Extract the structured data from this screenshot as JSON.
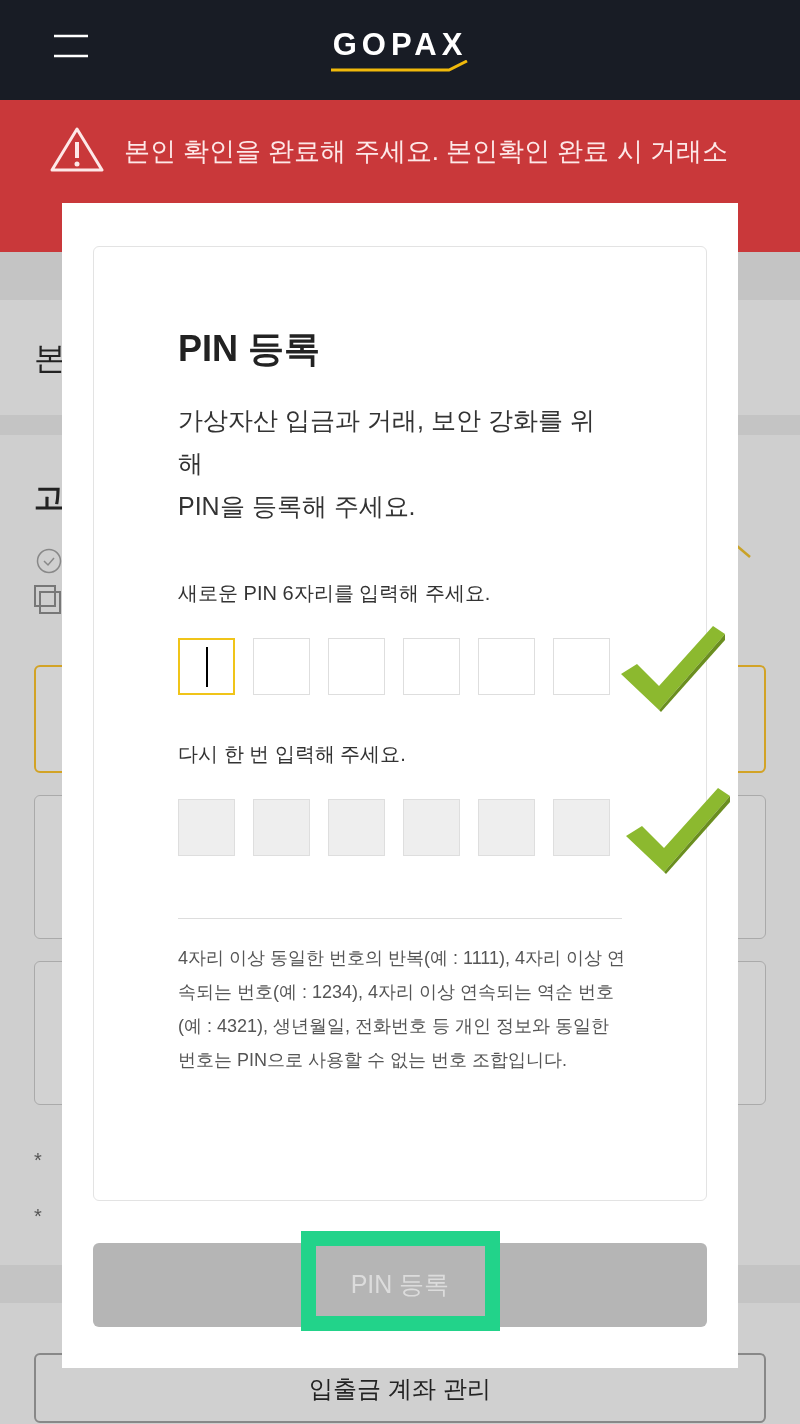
{
  "header": {
    "logo": "GOPAX"
  },
  "banner": {
    "message": "본인 확인을 완료해 주세요. 본인확인 완료 시 거래소"
  },
  "background": {
    "section_title": "본",
    "subsection_title": "고",
    "notes": [
      "*",
      "*"
    ],
    "bottom_button": "입출금 계좌 관리"
  },
  "modal": {
    "title": "PIN 등록",
    "description": [
      "가상자산 입금과 거래, 보안 강화를 위",
      "해",
      "PIN을 등록해 주세요."
    ],
    "pin_rows": [
      {
        "label": "새로운 PIN 6자리를 입력해 주세요.",
        "disabled": false,
        "cells": [
          {
            "focused": true
          },
          {
            "focused": false
          },
          {
            "focused": false
          },
          {
            "focused": false
          },
          {
            "focused": false
          },
          {
            "focused": false
          }
        ]
      },
      {
        "label": "다시 한 번 입력해 주세요.",
        "disabled": true,
        "cells": [
          {
            "focused": false
          },
          {
            "focused": false
          },
          {
            "focused": false
          },
          {
            "focused": false
          },
          {
            "focused": false
          },
          {
            "focused": false
          }
        ]
      }
    ],
    "note": "4자리 이상 동일한 번호의 반복(예 : 1111), 4자리 이상 연속되는 번호(예 : 1234), 4자리 이상 연속되는 역순 번호(예 : 4321), 생년월일, 전화번호 등 개인 정보와 동일한 번호는 PIN으로 사용할 수 없는 번호 조합입니다.",
    "submit_button": {
      "label": "PIN 등록",
      "disabled": true
    }
  }
}
